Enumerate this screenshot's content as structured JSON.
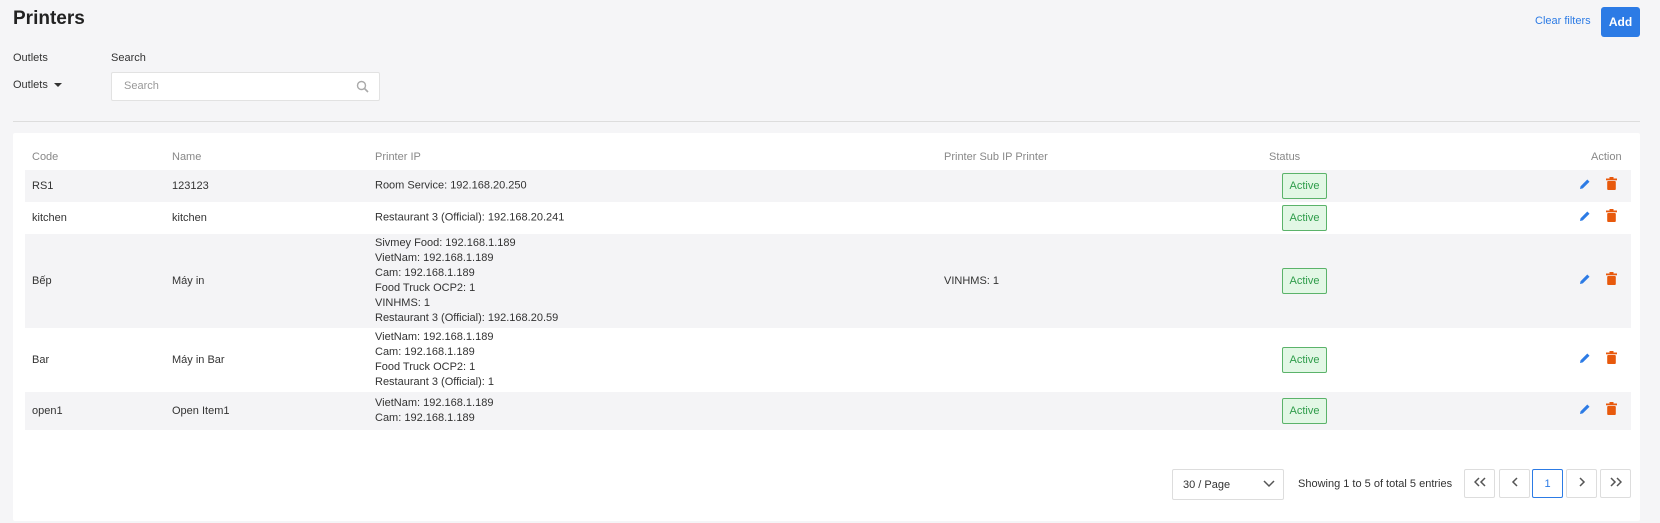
{
  "header": {
    "title": "Printers",
    "clear_filters": "Clear filters",
    "add_label": "Add"
  },
  "filters": {
    "outlets_label": "Outlets",
    "outlets_value": "Outlets",
    "search_label": "Search",
    "search_placeholder": "Search",
    "search_value": ""
  },
  "table": {
    "columns": [
      "Code",
      "Name",
      "Printer IP",
      "Printer Sub IP Printer",
      "Status",
      "Action"
    ],
    "rows": [
      {
        "code": "RS1",
        "name": "123123",
        "printer_ip": [
          "Room Service: 192.168.20.250"
        ],
        "sub_ip": "",
        "status": "Active"
      },
      {
        "code": "kitchen",
        "name": "kitchen",
        "printer_ip": [
          "Restaurant 3 (Official): 192.168.20.241"
        ],
        "sub_ip": "",
        "status": "Active"
      },
      {
        "code": "Bếp",
        "name": "Máy in",
        "printer_ip": [
          "Sivmey Food: 192.168.1.189",
          "VietNam: 192.168.1.189",
          "Cam: 192.168.1.189",
          "Food Truck OCP2: 1",
          "VINHMS: 1",
          "Restaurant 3 (Official): 192.168.20.59"
        ],
        "sub_ip": "VINHMS: 1",
        "status": "Active"
      },
      {
        "code": "Bar",
        "name": "Máy in Bar",
        "printer_ip": [
          "VietNam: 192.168.1.189",
          "Cam: 192.168.1.189",
          "Food Truck OCP2: 1",
          "Restaurant 3 (Official): 1"
        ],
        "sub_ip": "",
        "status": "Active"
      },
      {
        "code": "open1",
        "name": "Open Item1",
        "printer_ip": [
          "VietNam: 192.168.1.189",
          "Cam: 192.168.1.189"
        ],
        "sub_ip": "",
        "status": "Active"
      }
    ]
  },
  "pagination": {
    "page_size": "30 / Page",
    "showing": "Showing 1 to 5 of total 5 entries",
    "current_page": "1"
  },
  "colors": {
    "accent": "#2c7be5",
    "status_active_bg": "#e2f7e5",
    "status_active_text": "#2e9c4a",
    "delete": "#e8590c"
  }
}
